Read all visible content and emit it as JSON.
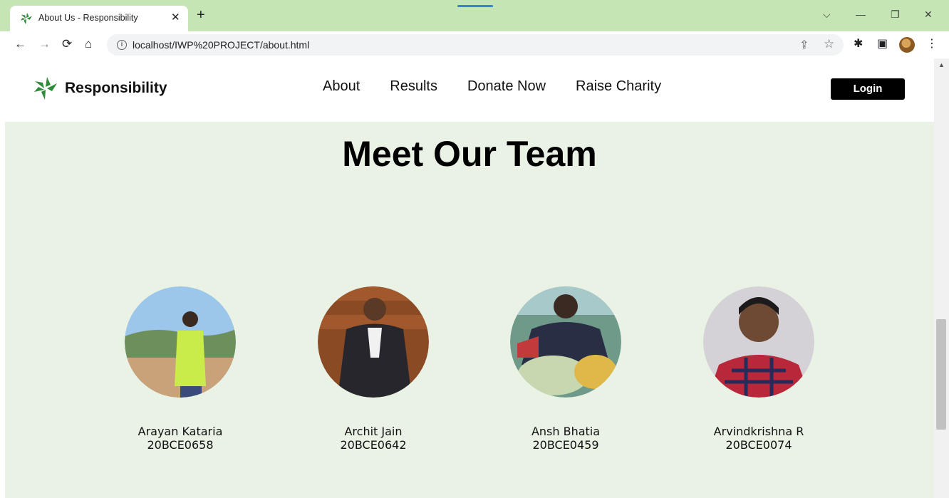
{
  "browser": {
    "tab_title": "About Us - Responsibility",
    "tab_close": "✕",
    "new_tab": "+",
    "url": "localhost/IWP%20PROJECT/about.html",
    "window_controls": {
      "tab_search": "⌵",
      "minimize": "—",
      "restore": "❐",
      "close": "✕"
    },
    "nav": {
      "back": "←",
      "forward": "→",
      "reload": "⟳",
      "home": "⌂"
    },
    "toolbar_icons": {
      "share": "⇪",
      "bookmark": "☆",
      "extensions": "✱",
      "side_panel": "▣",
      "menu": "⋮"
    }
  },
  "site": {
    "brand": "Responsibility",
    "nav_links": [
      "About",
      "Results",
      "Donate Now",
      "Raise Charity"
    ],
    "login_label": "Login",
    "colors": {
      "accent_green": "#2f8a3a",
      "section_bg": "#e9f2e5"
    }
  },
  "team": {
    "title": "Meet Our Team",
    "members": [
      {
        "name": "Arayan Kataria",
        "id": "20BCE0658",
        "photo": "person-photo"
      },
      {
        "name": "Archit Jain",
        "id": "20BCE0642",
        "photo": "person-photo"
      },
      {
        "name": "Ansh Bhatia",
        "id": "20BCE0459",
        "photo": "person-photo"
      },
      {
        "name": "Arvindkrishna R",
        "id": "20BCE0074",
        "photo": "person-photo"
      }
    ]
  }
}
